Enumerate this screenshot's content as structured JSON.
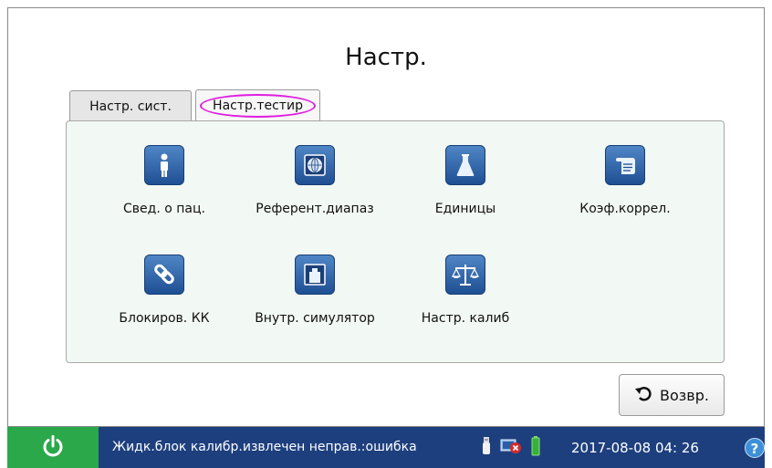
{
  "page": {
    "title": "Настр."
  },
  "tabs": [
    {
      "label": "Настр. сист.",
      "active": false
    },
    {
      "label": "Настр.тестир",
      "active": true
    }
  ],
  "items": [
    {
      "label": "Свед. о пац.",
      "icon": "person-icon"
    },
    {
      "label": "Референт.диапаз",
      "icon": "globe-icon"
    },
    {
      "label": "Единицы",
      "icon": "flask-icon"
    },
    {
      "label": "Коэф.коррел.",
      "icon": "scroll-icon"
    },
    {
      "label": "Блокиров. КК",
      "icon": "link-icon"
    },
    {
      "label": "Внутр. симулятор",
      "icon": "simulator-icon"
    },
    {
      "label": "Настр. калиб",
      "icon": "scale-icon"
    }
  ],
  "back_button": {
    "label": "Возвр."
  },
  "statusbar": {
    "message": "Жидк.блок калибр.извлечен неправ.:ошибка",
    "datetime": "2017-08-08 04: 26",
    "help": "?"
  },
  "colors": {
    "accent_blue": "#1f4f93",
    "statusbar_bg": "#1d3f7e",
    "power_green": "#2aa84a",
    "highlight_magenta": "#e01de0"
  }
}
